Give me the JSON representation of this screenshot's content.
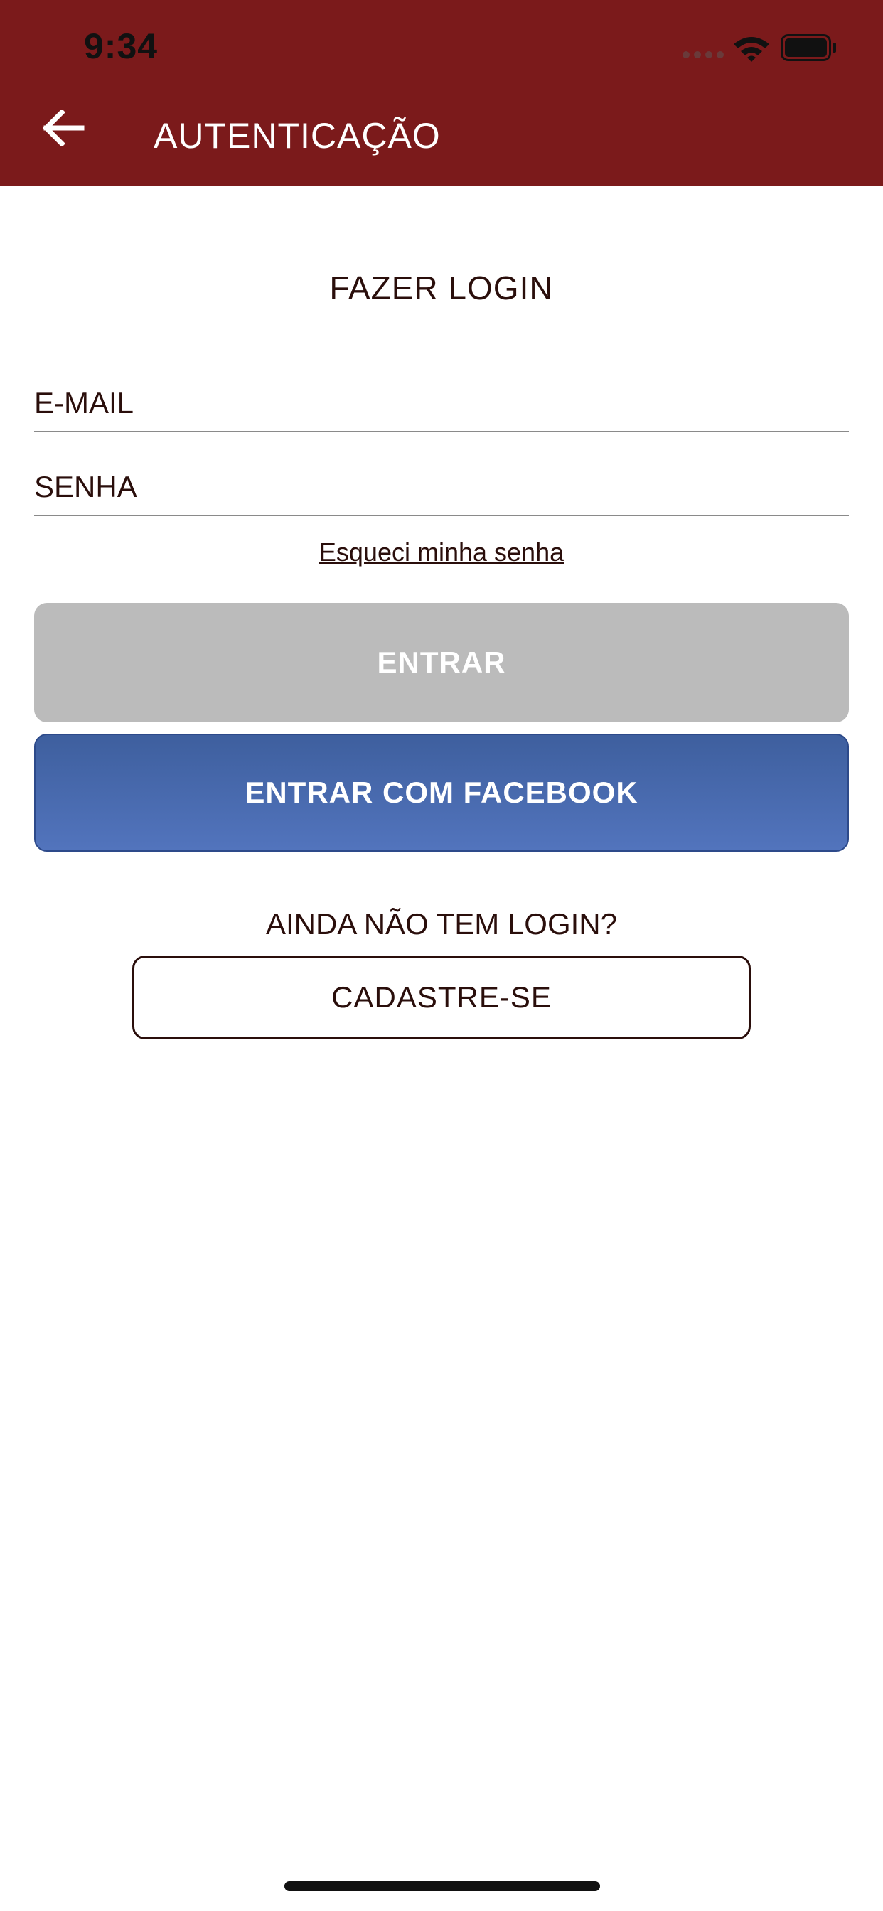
{
  "status_bar": {
    "time": "9:34"
  },
  "header": {
    "title": "AUTENTICAÇÃO",
    "back_icon": "arrow-left-icon",
    "background": "#7b1a1b"
  },
  "login": {
    "title": "FAZER LOGIN",
    "email_placeholder": "E-MAIL",
    "password_placeholder": "SENHA",
    "forgot_password": "Esqueci minha senha",
    "login_button": "ENTRAR",
    "facebook_button": "ENTRAR COM FACEBOOK"
  },
  "signup": {
    "prompt": "AINDA NÃO TEM LOGIN?",
    "button": "CADASTRE-SE"
  },
  "colors": {
    "accent": "#7b1a1b",
    "text": "#2a0e0b",
    "disabled_button": "#bbbbbb",
    "facebook": "#4a69b0"
  }
}
